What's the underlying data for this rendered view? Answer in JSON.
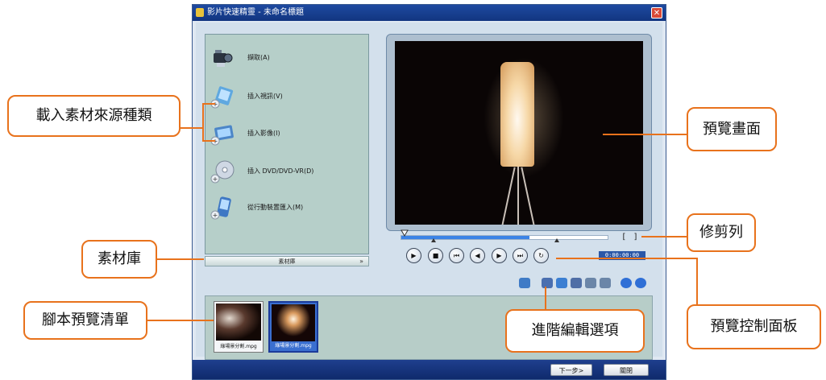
{
  "window": {
    "title": "影片快速精靈 - 未命名標題",
    "close_symbol": "✕",
    "next_button": "下一步>",
    "close_button": "關閉"
  },
  "capture_panel": {
    "items": [
      {
        "label": "擷取(A)",
        "icon": "camcorder-icon"
      },
      {
        "label": "插入視訊(V)",
        "icon": "insert-video-icon"
      },
      {
        "label": "插入影像(I)",
        "icon": "insert-image-icon"
      },
      {
        "label": "插入 DVD/DVD-VR(D)",
        "icon": "insert-dvd-icon"
      },
      {
        "label": "從行動裝置匯入(M)",
        "icon": "mobile-device-icon"
      }
    ],
    "library_button": "素材庫",
    "library_arrow": "»"
  },
  "preview": {
    "timecode": "0:00:00:00",
    "trim_in": "[",
    "trim_out": "]",
    "scrub_position": 0.62,
    "controls": [
      {
        "name": "play",
        "symbol": "▶"
      },
      {
        "name": "stop",
        "symbol": "■"
      },
      {
        "name": "home",
        "symbol": "⏮"
      },
      {
        "name": "previous-frame",
        "symbol": "◀"
      },
      {
        "name": "next-frame",
        "symbol": "▶"
      },
      {
        "name": "end",
        "symbol": "⏭"
      },
      {
        "name": "repeat",
        "symbol": "↻"
      }
    ]
  },
  "storyboard": {
    "clips": [
      {
        "label": "綠場景分割.mpg",
        "selected": false
      },
      {
        "label": "綠場景分割.mpg",
        "selected": true
      }
    ]
  },
  "callouts": {
    "source_types": "載入素材來源種類",
    "library": "素材庫",
    "storyboard": "腳本預覽清單",
    "preview_screen": "預覽畫面",
    "trim_bar": "修剪列",
    "preview_controls": "預覽控制面板",
    "advanced_edit": "進階編輯選項"
  },
  "colors": {
    "callout_border": "#e8721c",
    "titlebar": "#1e4aa0",
    "capture_panel": "#b6cfc9",
    "scrub_fill": "#3b83e6"
  }
}
